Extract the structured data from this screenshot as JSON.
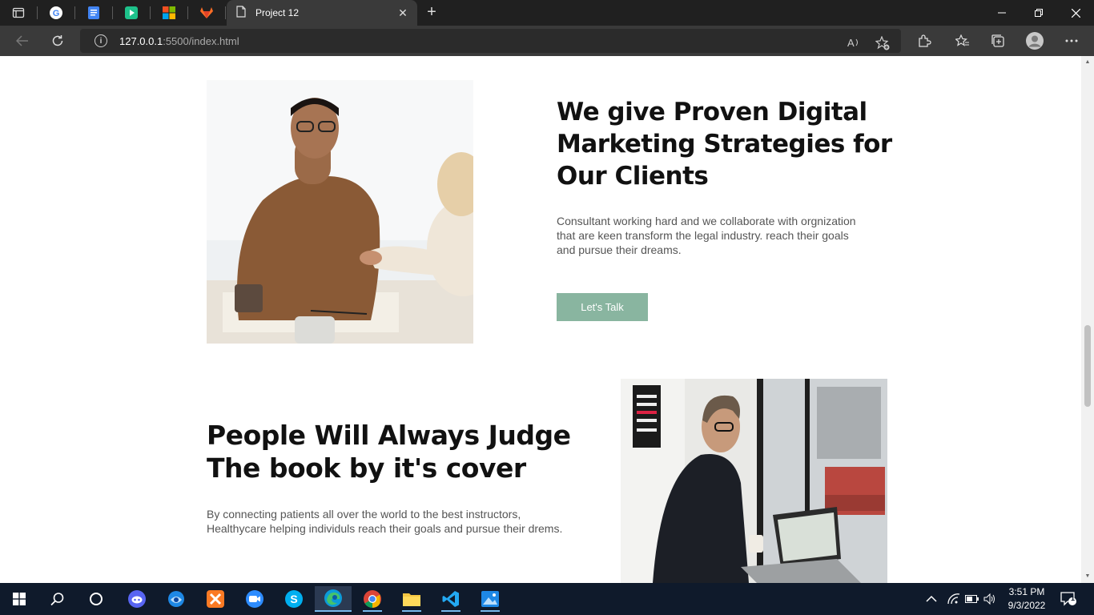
{
  "browser": {
    "tab_title": "Project 12",
    "url_host": "127.0.0.1",
    "url_rest": ":5500/index.html",
    "close_tab": "✕",
    "new_tab": "+"
  },
  "section1": {
    "heading": "We give Proven Digital Marketing Strategies for Our Clients",
    "body": "Consultant working hard and we collaborate with orgnization that are keen transform the legal industry. reach their goals and pursue their dreams.",
    "button_label": "Let's Talk",
    "button_color": "#89b5a0"
  },
  "section2": {
    "heading": "People Will Always Judge The book by it's cover",
    "body": "By connecting patients all over the world to the best instructors, Healthycare helping individuls reach their goals and pursue their drems."
  },
  "taskbar": {
    "time": "3:51 PM",
    "date": "9/3/2022",
    "notification_count": "1"
  },
  "colors": {
    "tabbar_bg": "#202020",
    "toolbar_bg": "#3a3a3a",
    "taskbar_bg": "#0f1a2b"
  }
}
